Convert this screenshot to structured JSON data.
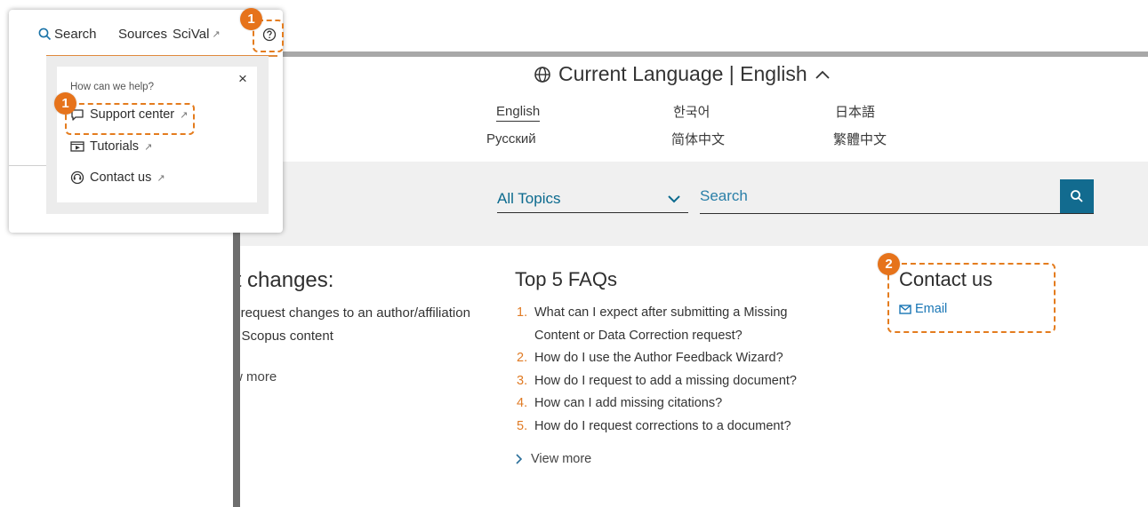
{
  "popup_nav": {
    "search": "Search",
    "sources": "Sources",
    "scival": "SciVal",
    "external_mark": "↗",
    "help_icon": "help-circle-icon"
  },
  "help_panel": {
    "heading": "How can we help?",
    "close": "×",
    "items": [
      {
        "label": "Support center",
        "icon": "chat-bubble-icon"
      },
      {
        "label": "Tutorials",
        "icon": "video-player-icon"
      },
      {
        "label": "Contact us",
        "icon": "contact-headset-icon"
      }
    ]
  },
  "language": {
    "title": "Current Language | English",
    "options": [
      "English",
      "한국어",
      "日本語",
      "Русский",
      "简体中文",
      "繁體中文"
    ],
    "selected": "English"
  },
  "search_bar": {
    "topics_label": "All Topics",
    "placeholder": "Search"
  },
  "left_column": {
    "title": "uest changes:",
    "desc_line1": "to request changes to an author/affiliation",
    "desc_line2": "or Scopus content",
    "view_more": "w more"
  },
  "faq": {
    "title": "Top 5 FAQs",
    "items": [
      {
        "num": "1.",
        "line1": "What can I expect after submitting a Missing",
        "line2": "Content or Data Correction request?"
      },
      {
        "num": "2.",
        "line1": "How do I use the Author Feedback Wizard?"
      },
      {
        "num": "3.",
        "line1": "How do I request to add a missing document?"
      },
      {
        "num": "4.",
        "line1": "How can I add missing citations?"
      },
      {
        "num": "5.",
        "line1": "How do I request corrections to a document?"
      }
    ],
    "view_more": "View more"
  },
  "contact": {
    "title": "Contact us",
    "email_label": "Email"
  },
  "annotations": {
    "badge_1": "1",
    "badge_2": "2"
  },
  "colors": {
    "accent_orange": "#e6731b",
    "link_blue": "#1976b5",
    "search_button": "#126b8f"
  }
}
